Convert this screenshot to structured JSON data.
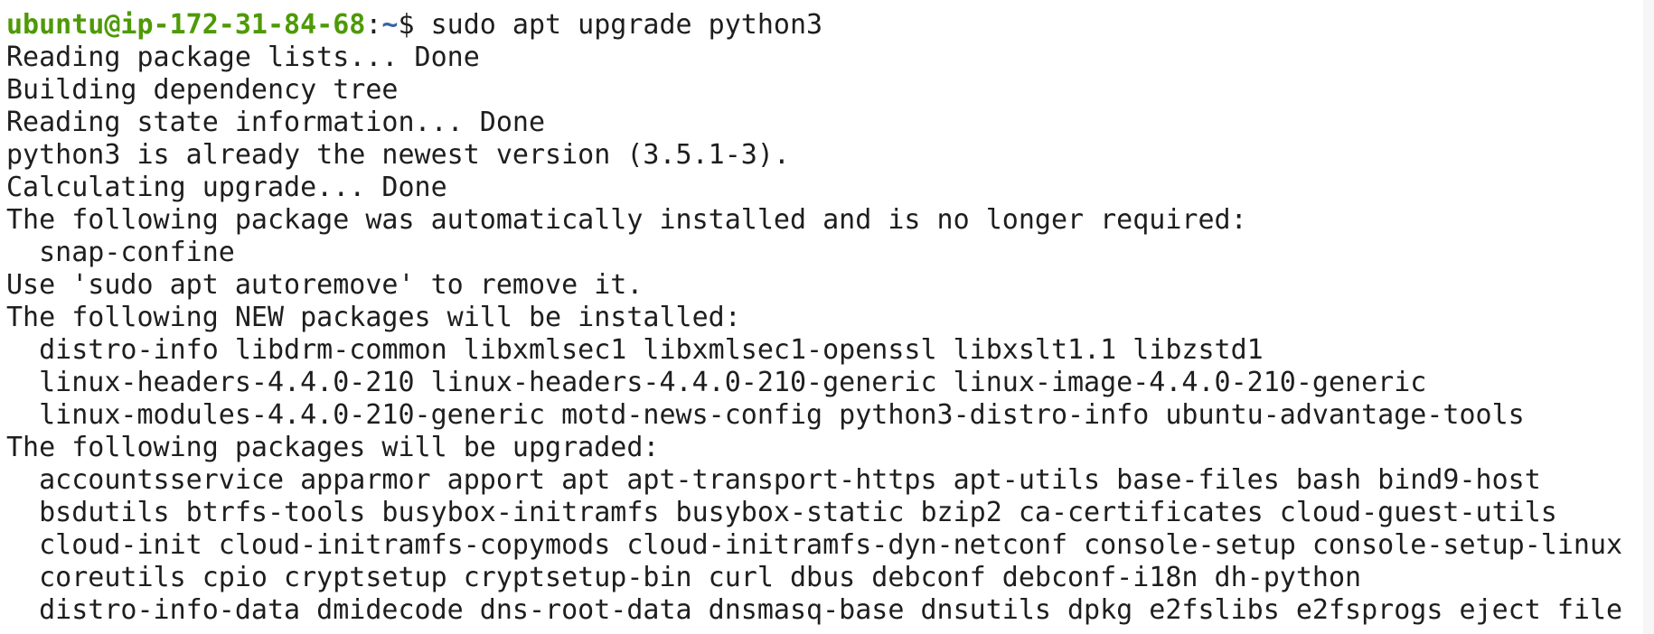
{
  "terminal": {
    "prompt": {
      "user_host": "ubuntu@ip-172-31-84-68",
      "separator": ":",
      "path": "~",
      "symbol": "$",
      "command": " sudo apt upgrade python3"
    },
    "output_lines": [
      "Reading package lists... Done",
      "Building dependency tree",
      "Reading state information... Done",
      "python3 is already the newest version (3.5.1-3).",
      "Calculating upgrade... Done",
      "The following package was automatically installed and is no longer required:",
      "  snap-confine",
      "Use 'sudo apt autoremove' to remove it.",
      "The following NEW packages will be installed:",
      "  distro-info libdrm-common libxmlsec1 libxmlsec1-openssl libxslt1.1 libzstd1",
      "  linux-headers-4.4.0-210 linux-headers-4.4.0-210-generic linux-image-4.4.0-210-generic",
      "  linux-modules-4.4.0-210-generic motd-news-config python3-distro-info ubuntu-advantage-tools",
      "The following packages will be upgraded:",
      "  accountsservice apparmor apport apt apt-transport-https apt-utils base-files bash bind9-host",
      "  bsdutils btrfs-tools busybox-initramfs busybox-static bzip2 ca-certificates cloud-guest-utils",
      "  cloud-init cloud-initramfs-copymods cloud-initramfs-dyn-netconf console-setup console-setup-linux",
      "  coreutils cpio cryptsetup cryptsetup-bin curl dbus debconf debconf-i18n dh-python",
      "  distro-info-data dmidecode dns-root-data dnsmasq-base dnsutils dpkg e2fslibs e2fsprogs eject file"
    ]
  }
}
